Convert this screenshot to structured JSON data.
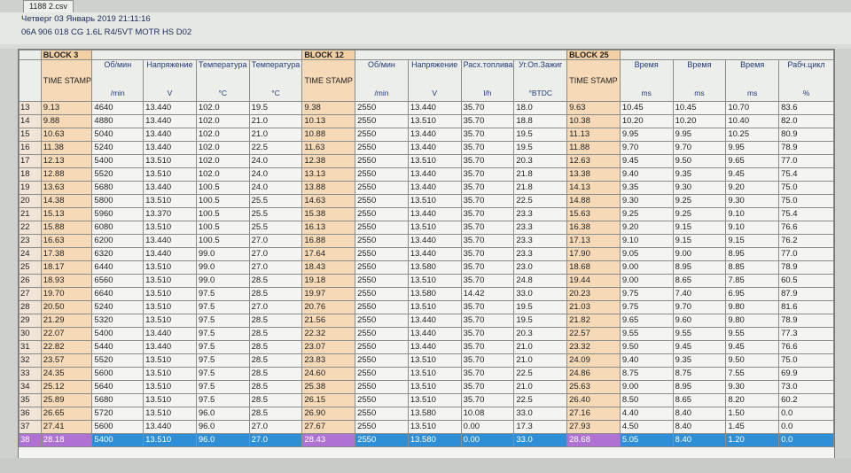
{
  "window": {
    "tab_title": "1188 2.csv",
    "datetime": "Четверг 03 Январь 2019 21:11:16",
    "vehicle": "06A 906 018 CG  1.6L R4/5VT MOTR HS D02"
  },
  "blocks": {
    "b1": "BLOCK 3",
    "b2": "BLOCK 12",
    "b3": "BLOCK 25"
  },
  "headers": [
    {
      "label": "",
      "unit": ""
    },
    {
      "label": "TIME STAMP",
      "unit": ""
    },
    {
      "label": "Об/мин",
      "unit": "/min"
    },
    {
      "label": "Напряжение",
      "unit": "V"
    },
    {
      "label": "Температура",
      "unit": "°C"
    },
    {
      "label": "Температура",
      "unit": "°C"
    },
    {
      "label": "TIME STAMP",
      "unit": ""
    },
    {
      "label": "Об/мин",
      "unit": "/min"
    },
    {
      "label": "Напряжение",
      "unit": "V"
    },
    {
      "label": "Расх.топлива",
      "unit": "l/h"
    },
    {
      "label": "Уг.Оп.Зажиг",
      "unit": "°BTDC"
    },
    {
      "label": "TIME STAMP",
      "unit": ""
    },
    {
      "label": "Время",
      "unit": "ms"
    },
    {
      "label": "Время",
      "unit": "ms"
    },
    {
      "label": "Время",
      "unit": "ms"
    },
    {
      "label": "Рабч.цикл",
      "unit": "%"
    }
  ],
  "rows": [
    [
      "13",
      "9.13",
      "4640",
      "13.440",
      "102.0",
      "19.5",
      "9.38",
      "2550",
      "13.440",
      "35.70",
      "18.0",
      "9.63",
      "10.45",
      "10.45",
      "10.70",
      "83.6"
    ],
    [
      "14",
      "9.88",
      "4880",
      "13.440",
      "102.0",
      "21.0",
      "10.13",
      "2550",
      "13.510",
      "35.70",
      "18.8",
      "10.38",
      "10.20",
      "10.20",
      "10.40",
      "82.0"
    ],
    [
      "15",
      "10.63",
      "5040",
      "13.440",
      "102.0",
      "21.0",
      "10.88",
      "2550",
      "13.440",
      "35.70",
      "19.5",
      "11.13",
      "9.95",
      "9.95",
      "10.25",
      "80.9"
    ],
    [
      "16",
      "11.38",
      "5240",
      "13.440",
      "102.0",
      "22.5",
      "11.63",
      "2550",
      "13.440",
      "35.70",
      "19.5",
      "11.88",
      "9.70",
      "9.70",
      "9.95",
      "78.9"
    ],
    [
      "17",
      "12.13",
      "5400",
      "13.510",
      "102.0",
      "24.0",
      "12.38",
      "2550",
      "13.510",
      "35.70",
      "20.3",
      "12.63",
      "9.45",
      "9.50",
      "9.65",
      "77.0"
    ],
    [
      "18",
      "12.88",
      "5520",
      "13.510",
      "102.0",
      "24.0",
      "13.13",
      "2550",
      "13.440",
      "35.70",
      "21.8",
      "13.38",
      "9.40",
      "9.35",
      "9.45",
      "75.4"
    ],
    [
      "19",
      "13.63",
      "5680",
      "13.440",
      "100.5",
      "24.0",
      "13.88",
      "2550",
      "13.440",
      "35.70",
      "21.8",
      "14.13",
      "9.35",
      "9.30",
      "9.20",
      "75.0"
    ],
    [
      "20",
      "14.38",
      "5800",
      "13.510",
      "100.5",
      "25.5",
      "14.63",
      "2550",
      "13.510",
      "35.70",
      "22.5",
      "14.88",
      "9.30",
      "9.25",
      "9.30",
      "75.0"
    ],
    [
      "21",
      "15.13",
      "5960",
      "13.370",
      "100.5",
      "25.5",
      "15.38",
      "2550",
      "13.440",
      "35.70",
      "23.3",
      "15.63",
      "9.25",
      "9.25",
      "9.10",
      "75.4"
    ],
    [
      "22",
      "15.88",
      "6080",
      "13.510",
      "100.5",
      "25.5",
      "16.13",
      "2550",
      "13.510",
      "35.70",
      "23.3",
      "16.38",
      "9.20",
      "9.15",
      "9.10",
      "76.6"
    ],
    [
      "23",
      "16.63",
      "6200",
      "13.440",
      "100.5",
      "27.0",
      "16.88",
      "2550",
      "13.440",
      "35.70",
      "23.3",
      "17.13",
      "9.10",
      "9.15",
      "9.15",
      "76.2"
    ],
    [
      "24",
      "17.38",
      "6320",
      "13.440",
      "99.0",
      "27.0",
      "17.64",
      "2550",
      "13.440",
      "35.70",
      "23.3",
      "17.90",
      "9.05",
      "9.00",
      "8.95",
      "77.0"
    ],
    [
      "25",
      "18.17",
      "6440",
      "13.510",
      "99.0",
      "27.0",
      "18.43",
      "2550",
      "13.580",
      "35.70",
      "23.0",
      "18.68",
      "9.00",
      "8.95",
      "8.85",
      "78.9"
    ],
    [
      "26",
      "18.93",
      "6560",
      "13.510",
      "99.0",
      "28.5",
      "19.18",
      "2550",
      "13.510",
      "35.70",
      "24.8",
      "19.44",
      "9.00",
      "8.65",
      "7.85",
      "60.5"
    ],
    [
      "27",
      "19.70",
      "6640",
      "13.510",
      "97.5",
      "28.5",
      "19.97",
      "2550",
      "13.580",
      "14.42",
      "33.0",
      "20.23",
      "9.75",
      "7.40",
      "6.95",
      "87.9"
    ],
    [
      "28",
      "20.50",
      "5240",
      "13.510",
      "97.5",
      "27.0",
      "20.76",
      "2550",
      "13.510",
      "35.70",
      "19.5",
      "21.03",
      "9.75",
      "9.70",
      "9.80",
      "81.6"
    ],
    [
      "29",
      "21.29",
      "5320",
      "13.510",
      "97.5",
      "28.5",
      "21.56",
      "2550",
      "13.440",
      "35.70",
      "19.5",
      "21.82",
      "9.65",
      "9.60",
      "9.80",
      "78.9"
    ],
    [
      "30",
      "22.07",
      "5400",
      "13.440",
      "97.5",
      "28.5",
      "22.32",
      "2550",
      "13.440",
      "35.70",
      "20.3",
      "22.57",
      "9.55",
      "9.55",
      "9.55",
      "77.3"
    ],
    [
      "31",
      "22.82",
      "5440",
      "13.440",
      "97.5",
      "28.5",
      "23.07",
      "2550",
      "13.440",
      "35.70",
      "21.0",
      "23.32",
      "9.50",
      "9.45",
      "9.45",
      "76.6"
    ],
    [
      "32",
      "23.57",
      "5520",
      "13.510",
      "97.5",
      "28.5",
      "23.83",
      "2550",
      "13.510",
      "35.70",
      "21.0",
      "24.09",
      "9.40",
      "9.35",
      "9.50",
      "75.0"
    ],
    [
      "33",
      "24.35",
      "5600",
      "13.510",
      "97.5",
      "28.5",
      "24.60",
      "2550",
      "13.510",
      "35.70",
      "22.5",
      "24.86",
      "8.75",
      "8.75",
      "7.55",
      "69.9"
    ],
    [
      "34",
      "25.12",
      "5640",
      "13.510",
      "97.5",
      "28.5",
      "25.38",
      "2550",
      "13.510",
      "35.70",
      "21.0",
      "25.63",
      "9.00",
      "8.95",
      "9.30",
      "73.0"
    ],
    [
      "35",
      "25.89",
      "5680",
      "13.510",
      "97.5",
      "28.5",
      "26.15",
      "2550",
      "13.510",
      "35.70",
      "22.5",
      "26.40",
      "8.50",
      "8.65",
      "8.20",
      "60.2"
    ],
    [
      "36",
      "26.65",
      "5720",
      "13.510",
      "96.0",
      "28.5",
      "26.90",
      "2550",
      "13.580",
      "10.08",
      "33.0",
      "27.16",
      "4.40",
      "8.40",
      "1.50",
      "0.0"
    ],
    [
      "37",
      "27.41",
      "5600",
      "13.440",
      "96.0",
      "27.0",
      "27.67",
      "2550",
      "13.510",
      "0.00",
      "17.3",
      "27.93",
      "4.50",
      "8.40",
      "1.45",
      "0.0"
    ],
    [
      "38",
      "28.18",
      "5400",
      "13.510",
      "96.0",
      "27.0",
      "28.43",
      "2550",
      "13.580",
      "0.00",
      "33.0",
      "28.68",
      "5.05",
      "8.40",
      "1.20",
      "0.0"
    ]
  ],
  "selected_row": 25
}
